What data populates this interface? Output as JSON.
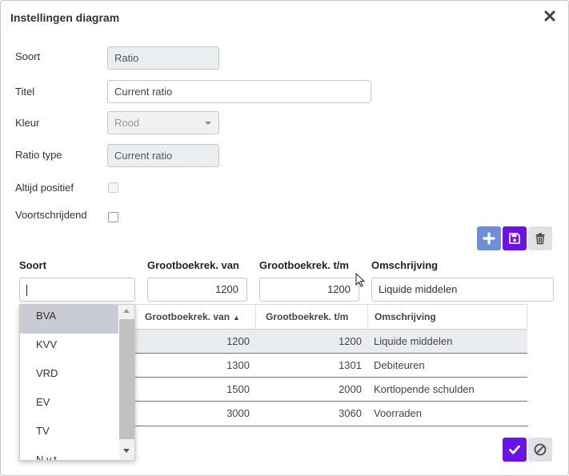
{
  "dialog": {
    "title": "Instellingen diagram"
  },
  "form": {
    "soort": {
      "label": "Soort",
      "value": "Ratio"
    },
    "titel": {
      "label": "Titel",
      "value": "Current ratio"
    },
    "kleur": {
      "label": "Kleur",
      "value": "Rood"
    },
    "ratio_type": {
      "label": "Ratio type",
      "value": "Current ratio"
    },
    "altijd_positief": {
      "label": "Altijd positief",
      "checked": false
    },
    "voortschrijdend": {
      "label": "Voortschrijdend",
      "checked": false
    }
  },
  "toolbar": {
    "add_icon": "plus-icon",
    "save_icon": "floppy-disk-icon",
    "delete_icon": "trash-icon"
  },
  "editor": {
    "headers": {
      "soort": "Soort",
      "van": "Grootboekrek. van",
      "tm": "Grootboekrek. t/m",
      "omschrijving": "Omschrijving"
    },
    "values": {
      "soort": "",
      "van": "1200",
      "tm": "1200",
      "omschrijving": "Liquide middelen"
    }
  },
  "grid": {
    "headers": {
      "van": "Grootboekrek. van",
      "tm": "Grootboekrek. t/m",
      "omschrijving": "Omschrijving"
    },
    "rows": [
      {
        "van": "1200",
        "tm": "1200",
        "omschrijving": "Liquide middelen"
      },
      {
        "van": "1300",
        "tm": "1301",
        "omschrijving": "Debiteuren"
      },
      {
        "van": "1500",
        "tm": "2000",
        "omschrijving": "Kortlopende schulden"
      },
      {
        "van": "3000",
        "tm": "3060",
        "omschrijving": "Voorraden"
      }
    ]
  },
  "dropdown": {
    "options": [
      "BVA",
      "KVV",
      "VRD",
      "EV",
      "TV",
      "N.v.t."
    ],
    "selected": "BVA"
  },
  "footer": {
    "confirm_icon": "check-icon",
    "cancel_icon": "ban-icon"
  },
  "colors": {
    "primary": "#6b12e8",
    "add_button": "#6e8ed6",
    "neutral_button": "#dfe1e4"
  }
}
